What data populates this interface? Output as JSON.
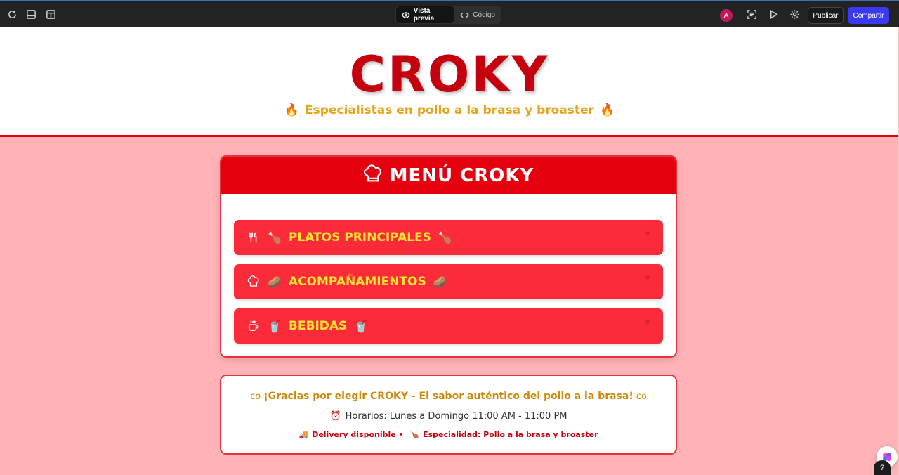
{
  "toolbar": {
    "preview_label": "Vista previa",
    "code_label": "Código",
    "avatar_initial": "A",
    "publish_label": "Publicar",
    "share_label": "Compartir"
  },
  "header": {
    "brand": "CROKY",
    "tagline": "Especialistas en pollo a la brasa y broaster",
    "tagline_emoji": "🔥"
  },
  "menu": {
    "title": "MENÚ CROKY",
    "categories": [
      {
        "label": "PLATOS PRINCIPALES",
        "emoji": "🍗",
        "icon": "utensils-icon"
      },
      {
        "label": "ACOMPAÑAMIENTOS",
        "emoji": "🥔",
        "icon": "chef-hat-icon"
      },
      {
        "label": "BEBIDAS",
        "emoji": "🥤",
        "icon": "coffee-cup-icon"
      }
    ]
  },
  "footer": {
    "thanks": "¡Gracias por elegir CROKY - El sabor auténtico del pollo a la brasa!",
    "thanks_side": "co",
    "hours_emoji": "⏰",
    "hours": "Horarios: Lunes a Domingo 11:00 AM - 11:00 PM",
    "delivery_emoji": "🚚",
    "delivery": "Delivery disponible •",
    "specialty_emoji": "🍗",
    "specialty": "Especialidad: Pollo a la brasa y broaster"
  },
  "help_label": "?",
  "colors": {
    "brand_red": "#c4000f",
    "menu_red": "#e4000f",
    "category_red": "#fb2b3a",
    "accent_yellow": "#ffe333",
    "tagline_gold": "#e8a317",
    "publish_blue": "#3a3af5"
  }
}
